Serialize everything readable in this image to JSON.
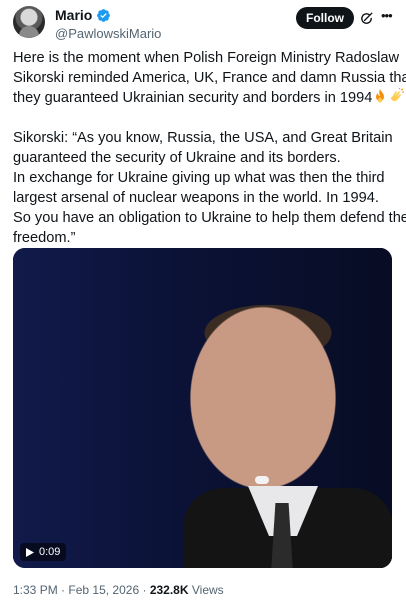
{
  "author": {
    "display_name": "Mario",
    "handle": "@PawlowskiMario",
    "verified_color": "#1d9bf0"
  },
  "actions": {
    "follow_label": "Follow",
    "grok_icon": "grok-icon",
    "more_icon": "more-icon"
  },
  "tweet": {
    "lines_p1": [
      "Here is the moment when Polish Foreign Ministry Radoslaw",
      "Sikorski reminded America, UK, France and damn Russia that",
      "they guaranteed Ukrainian security and borders in 1994"
    ],
    "emojis": [
      "fire-emoji",
      "clapping-hands-emoji"
    ],
    "lines_p2": [
      "Sikorski: “As you know, Russia, the USA, and Great Britain",
      "guaranteed the security of Ukraine and its borders.",
      "In exchange for Ukraine giving up what was then the third",
      "largest arsenal of nuclear weapons in the world. In 1994.",
      "So you have an obligation to Ukraine to help them defend their",
      "freedom.”"
    ]
  },
  "media": {
    "duration": "0:09"
  },
  "meta": {
    "time": "1:33 PM",
    "separator": "·",
    "date": "Feb 15, 2026",
    "views_count": "232.8K",
    "views_label": "Views"
  }
}
